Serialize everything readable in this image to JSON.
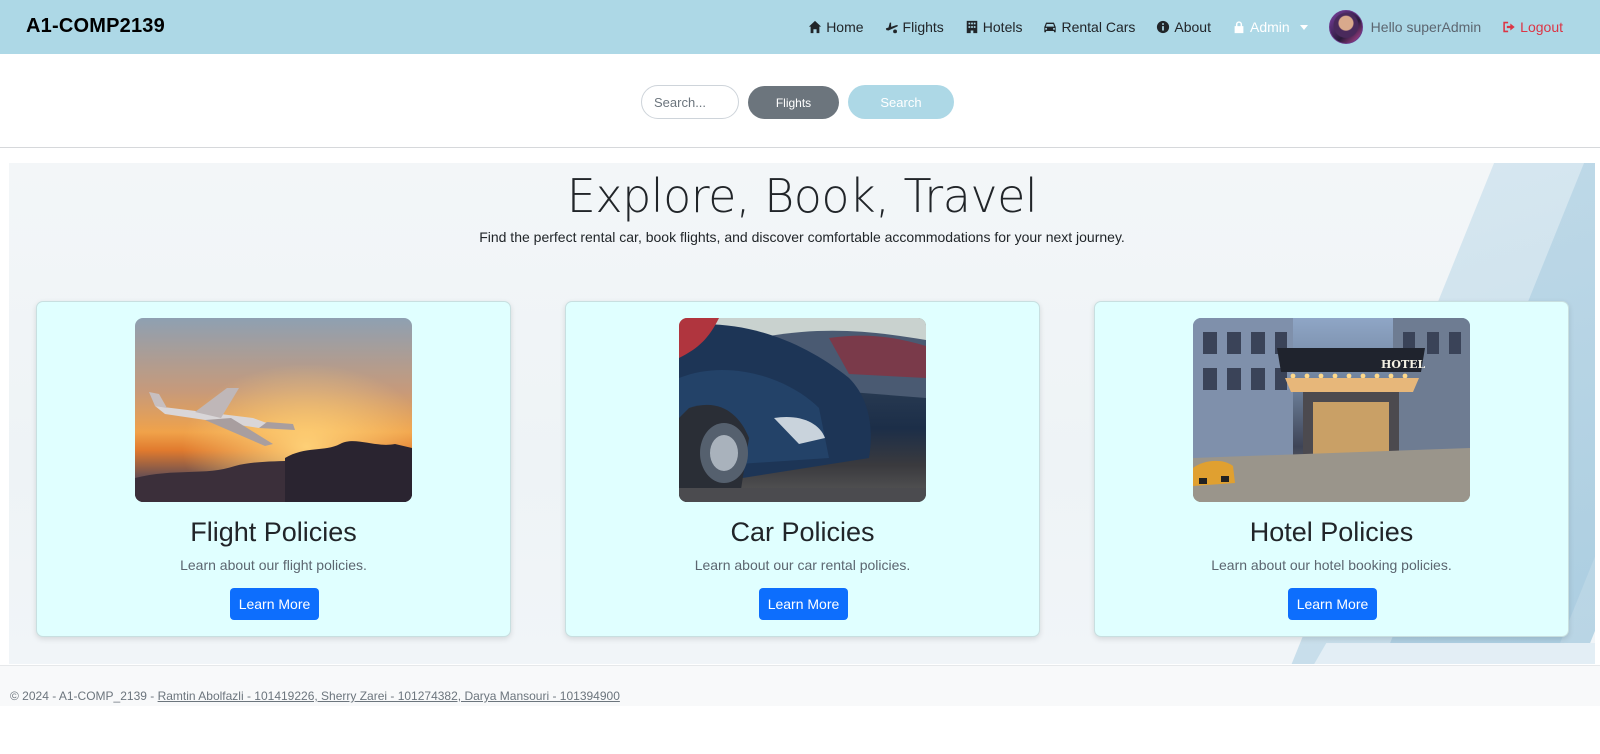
{
  "brand": "A1-COMP2139",
  "nav": {
    "home": "Home",
    "flights": "Flights",
    "hotels": "Hotels",
    "rental_cars": "Rental Cars",
    "about": "About",
    "admin": "Admin",
    "greeting": "Hello superAdmin",
    "logout": "Logout"
  },
  "search": {
    "placeholder": "Search...",
    "category_label": "Flights",
    "submit_label": "Search"
  },
  "hero": {
    "title": "Explore, Book, Travel",
    "subtitle": "Find the perfect rental car, book flights, and discover comfortable accommodations for your next journey."
  },
  "cards": [
    {
      "title": "Flight Policies",
      "text": "Learn about our flight policies.",
      "button": "Learn More",
      "image": "airplane-sunset-photo"
    },
    {
      "title": "Car Policies",
      "text": "Learn about our car rental policies.",
      "button": "Learn More",
      "image": "parked-cars-photo"
    },
    {
      "title": "Hotel Policies",
      "text": "Learn about our hotel booking policies.",
      "button": "Learn More",
      "image": "hotel-entrance-photo",
      "sign": "HOTEL"
    }
  ],
  "footer": {
    "copyright": "© 2024 - A1-COMP_2139 - ",
    "authors": "Ramtin Abolfazli - 101419226, Sherry Zarei - 101274382, Darya Mansouri - 101394900"
  },
  "colors": {
    "navbar": "#add8e6",
    "card_bg": "#e0ffff",
    "primary": "#0d6efd",
    "secondary": "#6c757d",
    "danger": "#dc3545"
  }
}
